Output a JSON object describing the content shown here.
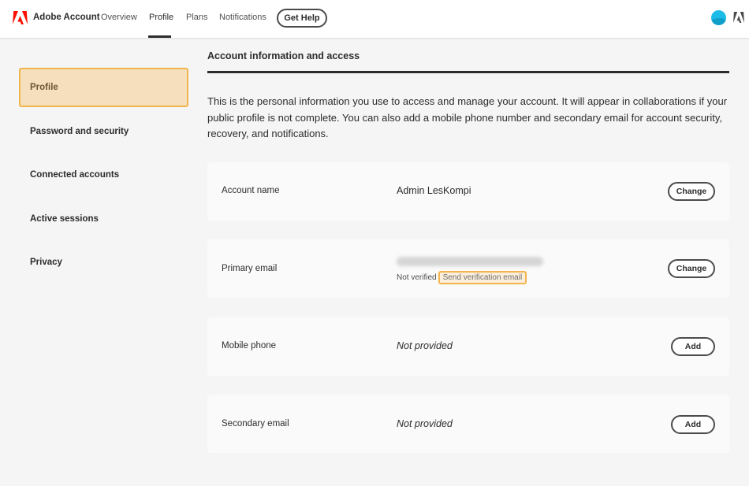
{
  "header": {
    "brand": "Adobe Account",
    "nav": [
      "Overview",
      "Profile",
      "Plans",
      "Notifications"
    ],
    "active_nav": "Profile",
    "help_label": "Get Help",
    "colors": {
      "logo": "#fa0f00",
      "avatar": "#1dbbe8"
    }
  },
  "sidebar": {
    "items": [
      {
        "label": "Profile",
        "selected": true
      },
      {
        "label": "Password and security",
        "selected": false
      },
      {
        "label": "Connected accounts",
        "selected": false
      },
      {
        "label": "Active sessions",
        "selected": false
      },
      {
        "label": "Privacy",
        "selected": false
      }
    ],
    "highlight_color": "#f2b54d"
  },
  "main": {
    "title": "Account information and access",
    "intro": "This is the personal information you use to access and manage your account. It will appear in collaborations if your public profile is not complete. You can also add a mobile phone number and secondary email for account security, recovery, and notifications.",
    "account_name": {
      "label": "Account name",
      "value": "Admin LesKompi",
      "button": "Change"
    },
    "primary_email": {
      "label": "Primary email",
      "status": "Not verified",
      "verify_link": "Send verification email",
      "button": "Change"
    },
    "mobile_phone": {
      "label": "Mobile phone",
      "value": "Not provided",
      "button": "Add"
    },
    "secondary_email": {
      "label": "Secondary email",
      "value": "Not provided",
      "button": "Add"
    }
  }
}
